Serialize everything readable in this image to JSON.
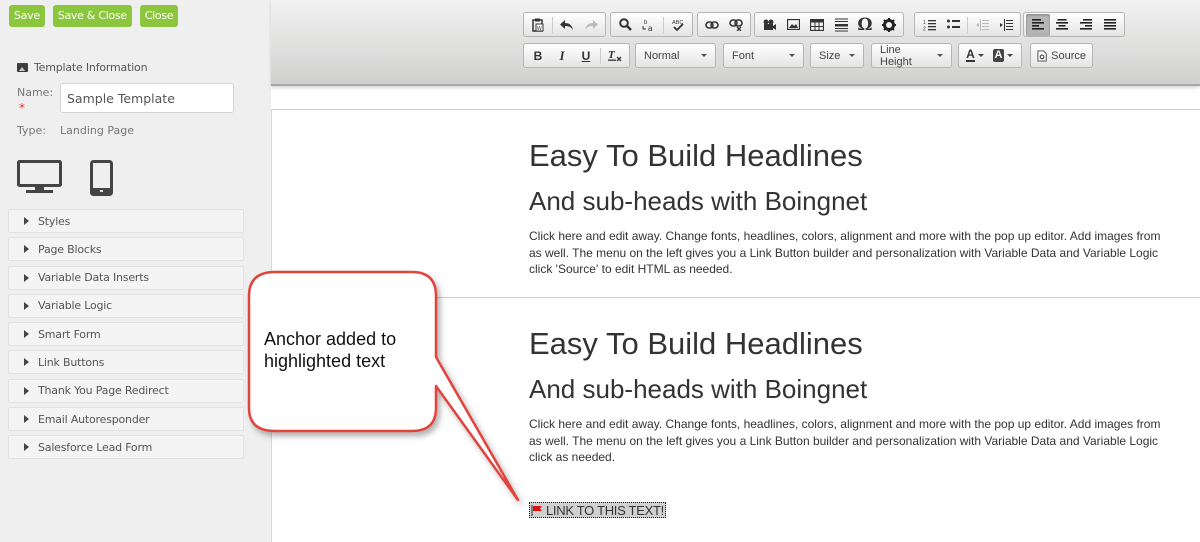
{
  "top_buttons": {
    "save": "Save",
    "save_close": "Save & Close",
    "close": "Close"
  },
  "template_info": {
    "heading": "Template Information",
    "name_label": "Name:",
    "required_mark": "*",
    "name_value": "Sample Template",
    "type_label": "Type:",
    "type_value": "Landing Page"
  },
  "devices": [
    "desktop",
    "mobile"
  ],
  "accordion": [
    {
      "label": "Styles"
    },
    {
      "label": "Page Blocks"
    },
    {
      "label": "Variable Data Inserts"
    },
    {
      "label": "Variable Logic"
    },
    {
      "label": "Smart Form"
    },
    {
      "label": "Link Buttons"
    },
    {
      "label": "Thank You Page Redirect"
    },
    {
      "label": "Email Autoresponder"
    },
    {
      "label": "Salesforce Lead Form"
    }
  ],
  "toolbar": {
    "format_combo": "Normal",
    "font_combo": "Font",
    "size_combo": "Size",
    "line_height_combo": "Line Height",
    "source_label": "Source",
    "bold": "B",
    "italic": "I",
    "underline": "U",
    "special_char": "Ω",
    "text_color": "A",
    "bg_color": "A",
    "active_alignment": "left"
  },
  "content": {
    "blocks": [
      {
        "headline": "Easy To Build Headlines",
        "subhead": "And sub-heads with Boingnet",
        "lines": [
          "Click here and edit away. Change fonts, headlines, colors, alignment and more with the pop up editor. Add images from",
          "as well. The menu on the left gives you a Link Button builder and personalization with Variable Data and Variable Logic",
          "click 'Source' to edit HTML as needed."
        ]
      },
      {
        "headline": "Easy To Build Headlines",
        "subhead": "And sub-heads with Boingnet",
        "lines": [
          "Click here and edit away. Change fonts, headlines, colors, alignment and more with the pop up editor. Add images from",
          "as well. The menu on the left gives you a Link Button builder and personalization with Variable Data and Variable Logic",
          "click as needed."
        ]
      }
    ],
    "anchor_text": "LINK TO THIS TEXT!"
  },
  "callout": {
    "line1": "Anchor added to",
    "line2": "highlighted text",
    "border_color": "#e0443e"
  },
  "colors": {
    "primary_button": "#8cc63f",
    "required": "#e53935"
  }
}
